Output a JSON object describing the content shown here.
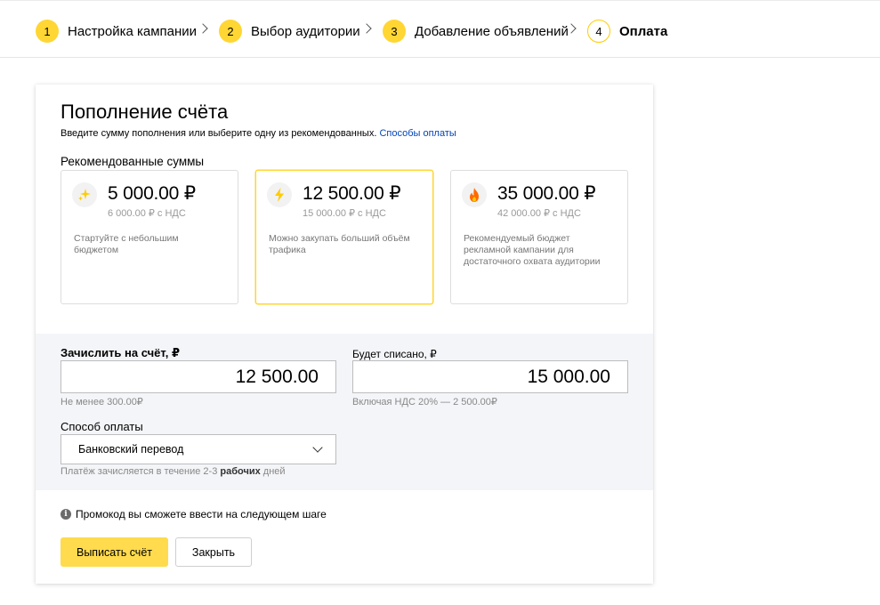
{
  "stepper": {
    "steps": [
      {
        "num": "1",
        "label": "Настройка кампании"
      },
      {
        "num": "2",
        "label": "Выбор аудитории"
      },
      {
        "num": "3",
        "label": "Добавление объявлений"
      },
      {
        "num": "4",
        "label": "Оплата"
      }
    ],
    "active_step": 4,
    "accent_color": "#ffd633"
  },
  "card": {
    "title": "Пополнение счёта",
    "subtitle": "Введите сумму пополнения или выберите одну из рекомендованных.",
    "payment_methods_link": "Способы оплаты",
    "recommended_title": "Рекомендованные суммы",
    "options": [
      {
        "icon": "sparkles-icon",
        "amount": "5 000.00 ₽",
        "vat": "6 000.00 ₽ с НДС",
        "description": "Стартуйте с небольшим бюджетом",
        "selected": false
      },
      {
        "icon": "lightning-icon",
        "amount": "12 500.00 ₽",
        "vat": "15 000.00 ₽ с НДС",
        "description": "Можно закупать больший объём трафика",
        "selected": true
      },
      {
        "icon": "fire-icon",
        "amount": "35 000.00 ₽",
        "vat": "42 000.00 ₽ с НДС",
        "description": "Рекомендуемый бюджет рекламной кампании для достаточного охвата аудитории",
        "selected": false
      }
    ]
  },
  "form": {
    "credit_label": "Зачислить на счёт, ₽",
    "credit_value": "12 500.00",
    "credit_hint": "Не менее 300.00₽",
    "charge_label": "Будет списано, ₽",
    "charge_value": "15 000.00",
    "charge_hint": "Включая НДС 20% — 2 500.00₽",
    "payment_method_label": "Способ оплаты",
    "payment_method_value": "Банковский перевод",
    "payment_hint_prefix": "Платёж зачисляется в течение 2-3",
    "payment_hint_bold": "рабочих",
    "payment_hint_suffix": "дней"
  },
  "footer": {
    "promo_text": "Промокод вы сможете ввести на следующем шаге",
    "invoice_button": "Выписать счёт",
    "close_button": "Закрыть"
  }
}
